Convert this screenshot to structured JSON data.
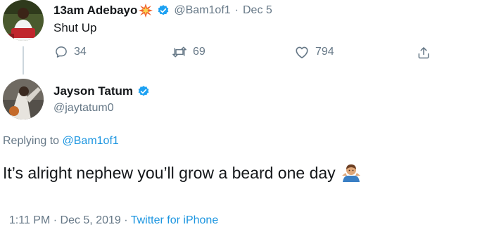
{
  "parent_tweet": {
    "display_name": "13am Adebayo",
    "handle": "@Bam1of1",
    "separator": "·",
    "date": "Dec 5",
    "text": "Shut Up",
    "actions": {
      "replies": "34",
      "retweets": "69",
      "likes": "794"
    },
    "icons": [
      "collision-emoji-icon",
      "verified-icon",
      "reply-icon",
      "retweet-icon",
      "like-icon",
      "share-icon"
    ]
  },
  "reply_tweet": {
    "display_name": "Jayson Tatum",
    "handle": "@jaytatum0",
    "replying_to_label": "Replying to",
    "replying_to_handle": "@Bam1of1",
    "text": "It’s alright nephew you’ll grow a beard one day",
    "emoji": "man-shrugging-emoji-icon",
    "timestamp": "1:11 PM · Dec 5, 2019 · ",
    "source": "Twitter for iPhone"
  },
  "colors": {
    "verified": "#1da1f2",
    "link": "#1b95e0",
    "muted": "#657786",
    "text": "#14171a",
    "thread_line": "#ccd6dd"
  }
}
